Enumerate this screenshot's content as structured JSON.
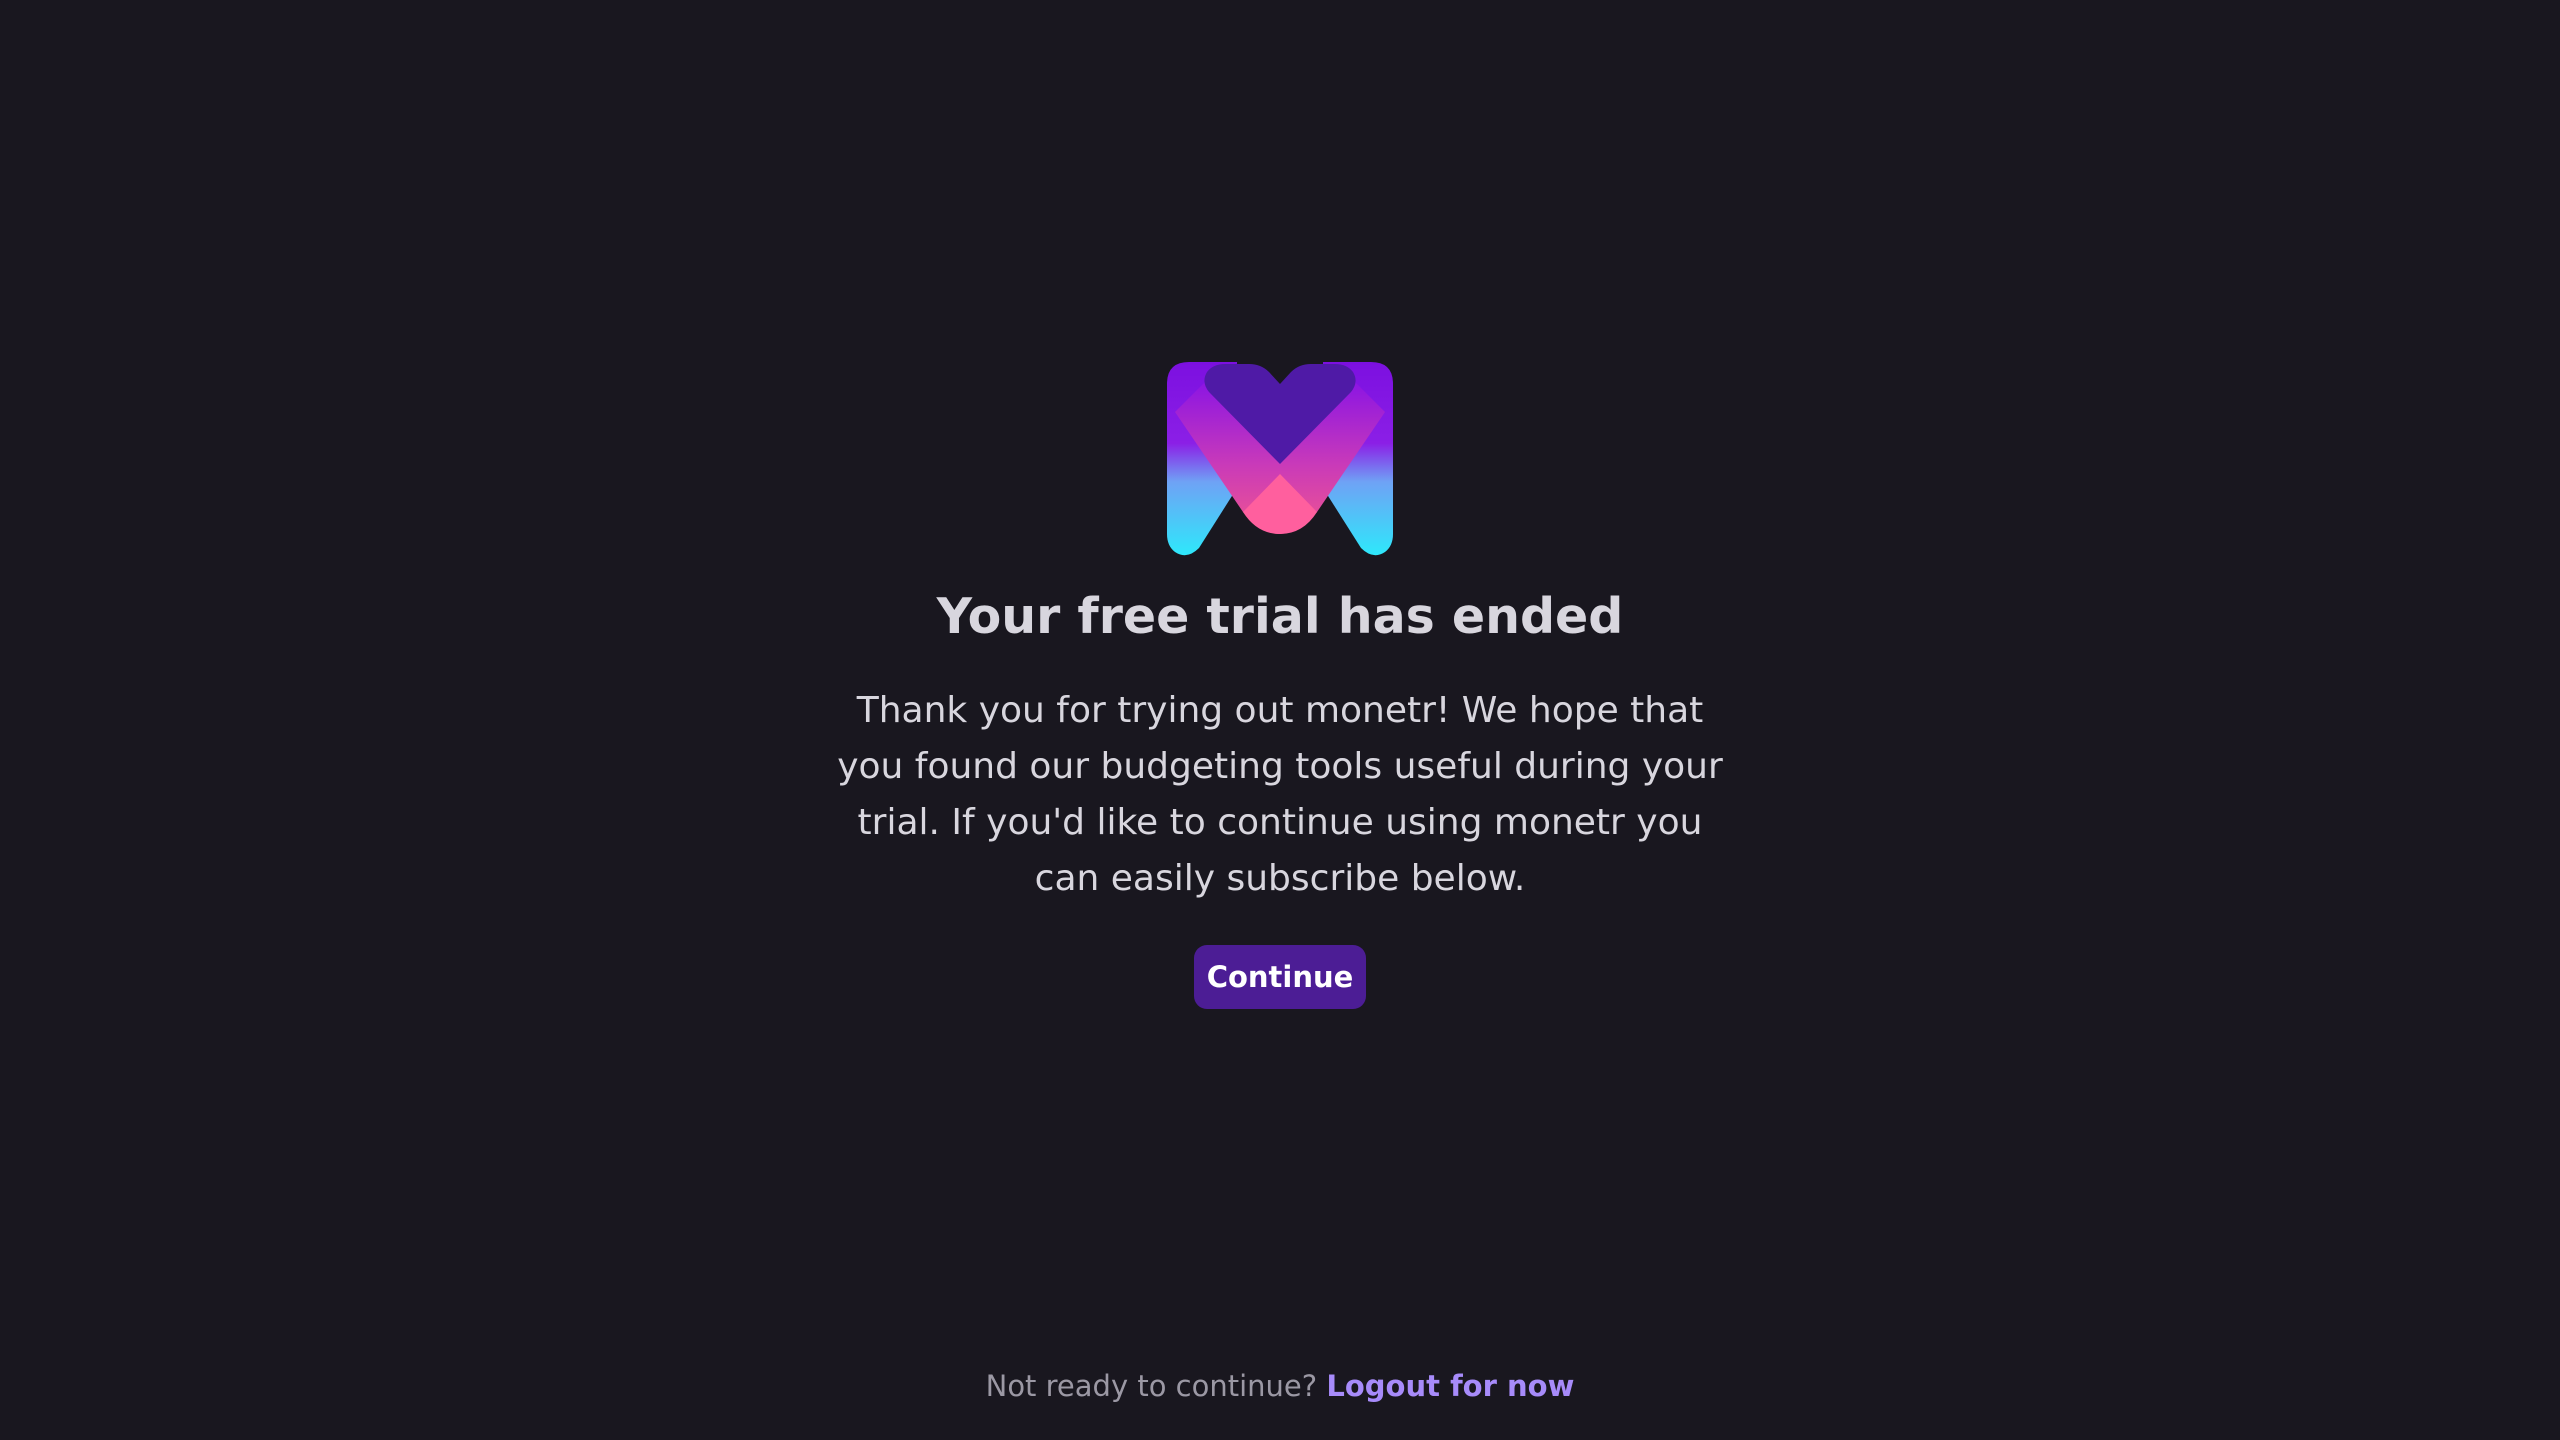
{
  "app": {
    "logo_icon": "monetr-logo-icon",
    "colors": {
      "background": "#19171f",
      "accent": "#4c1d95",
      "link": "#a78bfa",
      "text": "#d8d6de",
      "muted": "#9b98a4"
    }
  },
  "trial": {
    "title": "Your free trial has ended",
    "message": "Thank you for trying out monetr! We hope that you found our budgeting tools useful during your trial. If you'd like to continue using monetr you can easily subscribe below.",
    "continue_label": "Continue"
  },
  "footer": {
    "prompt": "Not ready to continue?",
    "logout_label": "Logout for now"
  }
}
